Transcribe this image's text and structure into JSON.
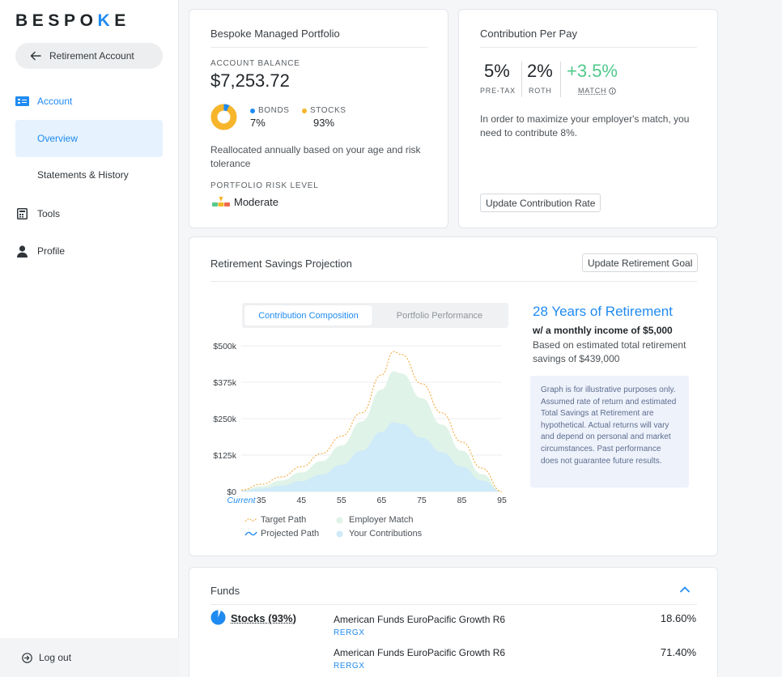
{
  "sidebar": {
    "logo_prefix": "BESPO",
    "logo_accent": "K",
    "logo_suffix": "E",
    "back_label": "Retirement Account",
    "nav": {
      "account": "Account",
      "overview": "Overview",
      "statements": "Statements & History",
      "tools": "Tools",
      "profile": "Profile"
    },
    "logout": "Log out"
  },
  "portfolio": {
    "title": "Bespoke Managed Portfolio",
    "balance_label": "ACCOUNT BALANCE",
    "balance": "$7,253.72",
    "bonds_label": "BONDS",
    "bonds_value": "7%",
    "bonds_fraction": 0.07,
    "stocks_label": "STOCKS",
    "stocks_value": "93%",
    "note": "Reallocated annually based on your age and risk tolerance",
    "risk_label": "PORTFOLIO RISK LEVEL",
    "risk_value": "Moderate"
  },
  "contribution": {
    "title": "Contribution Per Pay",
    "pretax_value": "5%",
    "pretax_label": "PRE-TAX",
    "roth_value": "2%",
    "roth_label": "ROTH",
    "match_value": "+3.5%",
    "match_label": "MATCH",
    "note": "In order to maximize your employer's match, you need to contribute 8%.",
    "button": "Update Contribution Rate"
  },
  "projection": {
    "title": "Retirement Savings Projection",
    "goal_button": "Update Retirement Goal",
    "tab_active": "Contribution Composition",
    "tab_inactive": "Portfolio Performance",
    "years_title": "28 Years of Retirement",
    "income": "w/ a monthly income of $5,000",
    "savings_note": "Based on estimated total retirement savings of $439,000",
    "disclaimer": "Graph is for illustrative purposes only. Assumed rate of return and estimated Total Savings at Retirement are hypothetical. Actual returns will vary and depend on personal and market circumstances. Past performance does not guarantee future results.",
    "legend": {
      "target": "Target Path",
      "employer": "Employer Match",
      "projected": "Projected Path",
      "contributions": "Your Contributions"
    }
  },
  "chart_data": {
    "type": "area",
    "x": [
      30,
      35,
      40,
      45,
      50,
      55,
      60,
      65,
      68,
      70,
      75,
      80,
      85,
      90,
      95
    ],
    "x_tick_labels": [
      "Current",
      "35",
      "45",
      "55",
      "65",
      "75",
      "85",
      "95"
    ],
    "x_tick_values": [
      30,
      35,
      45,
      55,
      65,
      75,
      85,
      95
    ],
    "y_tick_labels": [
      "$0",
      "$125k",
      "$250k",
      "$375k",
      "$500k"
    ],
    "ylim": [
      0,
      500000
    ],
    "series": [
      {
        "name": "Target Path",
        "values": [
          5000,
          25000,
          50000,
          85000,
          130000,
          190000,
          270000,
          400000,
          480000,
          470000,
          370000,
          270000,
          170000,
          80000,
          0
        ]
      },
      {
        "name": "Employer Match",
        "values": [
          4000,
          18000,
          38000,
          66000,
          104000,
          158000,
          240000,
          350000,
          412000,
          405000,
          320000,
          230000,
          140000,
          60000,
          0
        ]
      },
      {
        "name": "Your Contributions",
        "values": [
          3000,
          10000,
          20000,
          36000,
          58000,
          92000,
          140000,
          205000,
          238000,
          233000,
          185000,
          135000,
          85000,
          38000,
          0
        ]
      }
    ],
    "colors": {
      "target": "#f4b04a",
      "employer": "#dff3e8",
      "contributions": "#cfeaf8",
      "projected": "#1f8bf0",
      "accent": "#1f8bf0",
      "match_green": "#4fc98c",
      "bonds": "#1f8bf0",
      "stocks": "#f6b52a"
    }
  },
  "funds": {
    "title": "Funds",
    "category": "Stocks (93%)",
    "rows": [
      {
        "name": "American Funds EuroPacific Growth R6",
        "ticker": "RERGX",
        "pct": "18.60%"
      },
      {
        "name": "American Funds EuroPacific Growth R6",
        "ticker": "RERGX",
        "pct": "71.40%"
      }
    ]
  }
}
